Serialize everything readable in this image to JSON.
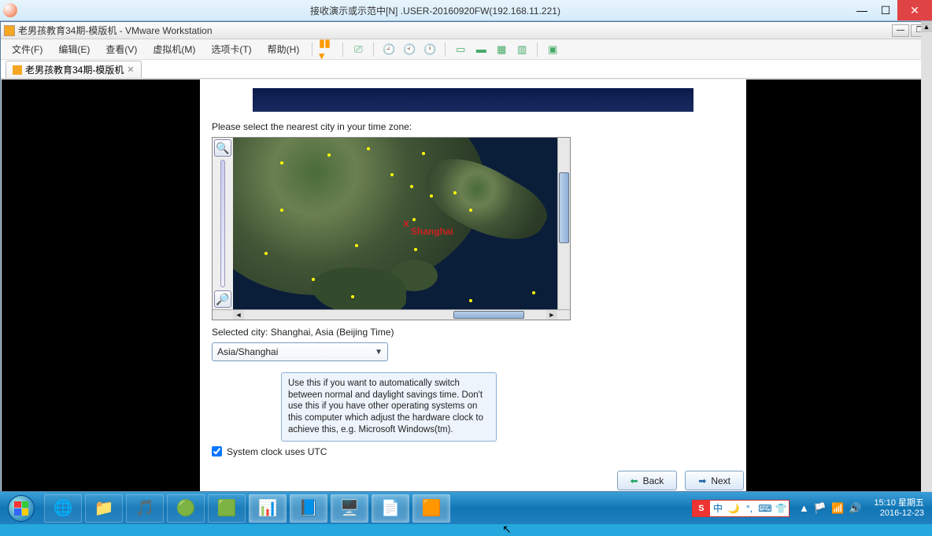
{
  "outer_window": {
    "title": "接收演示或示范中[N] .USER-20160920FW(192.168.11.221)"
  },
  "vmware": {
    "title": "老男孩教育34期-模版机 - VMware Workstation",
    "menus": [
      "文件(F)",
      "编辑(E)",
      "查看(V)",
      "虚拟机(M)",
      "选项卡(T)",
      "帮助(H)"
    ],
    "tab_label": "老男孩教育34期-模版机"
  },
  "installer": {
    "prompt": "Please select the nearest city in your time zone:",
    "selected_label_prefix": "Selected city: ",
    "selected_city_full": "Shanghai, Asia (Beijing Time)",
    "map_selected_label": "Shanghai",
    "tz_value": "Asia/Shanghai",
    "tooltip": "Use this if you want to automatically switch between normal and daylight savings time. Don't use this if you have other operating systems on this computer which adjust the hardware clock to achieve this, e.g. Microsoft Windows(tm).",
    "utc_label": "System clock uses UTC",
    "utc_checked": true,
    "back_label": "Back",
    "next_label": "Next"
  },
  "taskbar": {
    "clock_time": "15:10",
    "clock_day": "星期五",
    "clock_date": "2016-12-23",
    "ime_letter": "S",
    "ime_zhong": "中"
  }
}
